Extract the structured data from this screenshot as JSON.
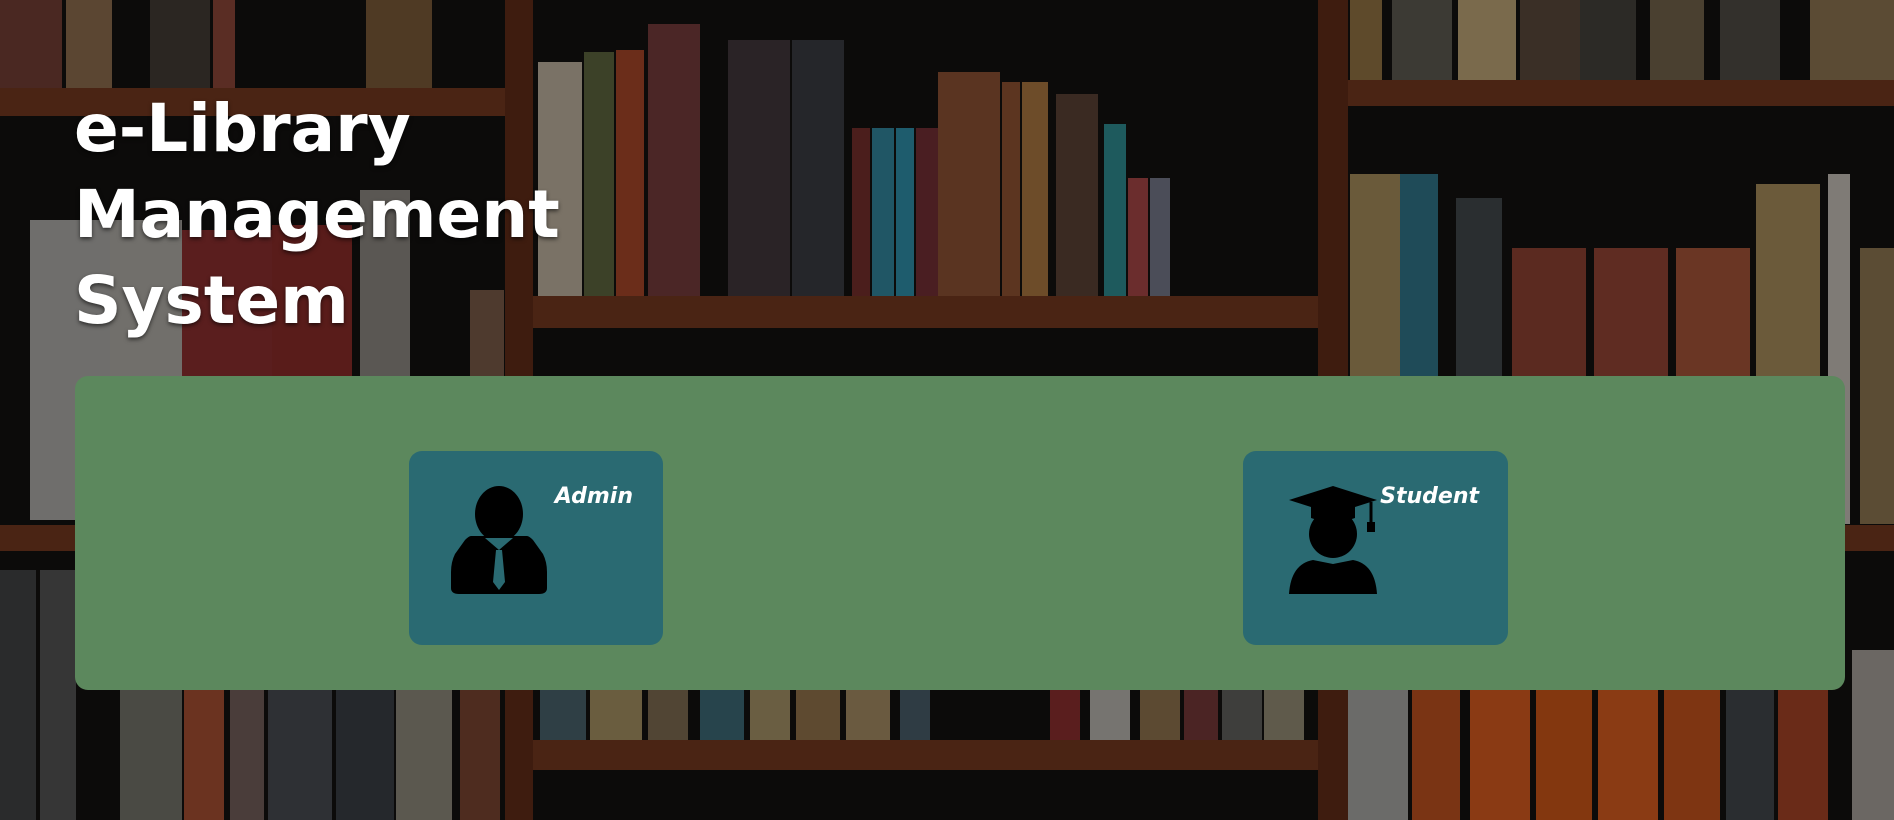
{
  "app": {
    "title_lines": [
      "e-Library",
      "Management",
      "System"
    ]
  },
  "roles": [
    {
      "label": "Admin",
      "icon": "admin-icon"
    },
    {
      "label": "Student",
      "icon": "graduate-icon"
    }
  ],
  "colors": {
    "panel": "#5c885d",
    "card": "#2a6a72",
    "title_text": "#ffffff"
  }
}
